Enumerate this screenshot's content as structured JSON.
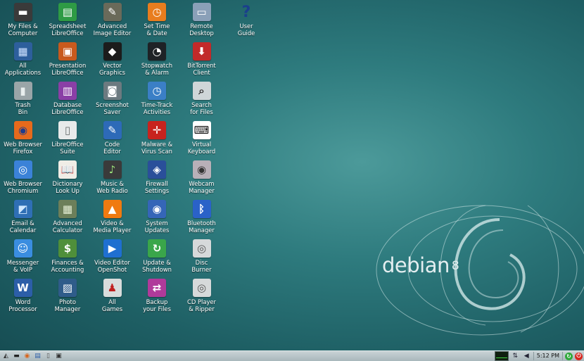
{
  "desktop_icons": [
    {
      "label": "My Files &\nComputer",
      "glyph": "▬",
      "bg": "#3a3a3a",
      "fg": "#ffffff"
    },
    {
      "label": "All\nApplications",
      "glyph": "▦",
      "bg": "#2d5f9c",
      "fg": "#cfe2ff"
    },
    {
      "label": "Trash\nBin",
      "glyph": "▮",
      "bg": "#9aa5a8",
      "fg": "#e8eeee"
    },
    {
      "label": "Web Browser\nFirefox",
      "glyph": "◉",
      "bg": "#e66a1c",
      "fg": "#1e3c8c"
    },
    {
      "label": "Web Browser\nChromium",
      "glyph": "◎",
      "bg": "#3b82d8",
      "fg": "#ffffff"
    },
    {
      "label": "Email &\nCalendar",
      "glyph": "◩",
      "bg": "#2f6fb5",
      "fg": "#cfe7ff"
    },
    {
      "label": "Messenger\n& VoIP",
      "glyph": "☺",
      "bg": "#3a8de0",
      "fg": "#ffffff"
    },
    {
      "label": "Word\nProcessor",
      "glyph": "W",
      "bg": "#2c5ea8",
      "fg": "#ffffff"
    },
    {
      "label": "Spreadsheet\nLibreOffice",
      "glyph": "▤",
      "bg": "#2e9b45",
      "fg": "#ffffff"
    },
    {
      "label": "Presentation\nLibreOffice",
      "glyph": "▣",
      "bg": "#c85a1e",
      "fg": "#ffffff"
    },
    {
      "label": "Database\nLibreOffice",
      "glyph": "▥",
      "bg": "#8a3fa6",
      "fg": "#ffffff"
    },
    {
      "label": "LibreOffice\nSuite",
      "glyph": "▯",
      "bg": "#e8eaea",
      "fg": "#6b7070"
    },
    {
      "label": "Dictionary\nLook Up",
      "glyph": "📖",
      "bg": "#f0ede6",
      "fg": "#8a2020"
    },
    {
      "label": "Advanced\nCalculator",
      "glyph": "▦",
      "bg": "#6c7f5a",
      "fg": "#e6f0d8"
    },
    {
      "label": "Finances &\nAccounting",
      "glyph": "$",
      "bg": "#4f8f3a",
      "fg": "#ffffff"
    },
    {
      "label": "Photo\nManager",
      "glyph": "▨",
      "bg": "#2f5c8a",
      "fg": "#ffffff"
    },
    {
      "label": "Advanced\nImage Editor",
      "glyph": "✎",
      "bg": "#6a6a5a",
      "fg": "#ffffff"
    },
    {
      "label": "Vector\nGraphics",
      "glyph": "◆",
      "bg": "#1c1c1c",
      "fg": "#ffffff"
    },
    {
      "label": "Screenshot\nSaver",
      "glyph": "◙",
      "bg": "#6c7a80",
      "fg": "#ffffff"
    },
    {
      "label": "Code\nEditor",
      "glyph": "✎",
      "bg": "#2d6ab8",
      "fg": "#ffffff"
    },
    {
      "label": "Music &\nWeb Radio",
      "glyph": "♪",
      "bg": "#3a3a3a",
      "fg": "#9be27a"
    },
    {
      "label": "Video &\nMedia Player",
      "glyph": "▲",
      "bg": "#f07a10",
      "fg": "#ffffff"
    },
    {
      "label": "Video Editor\nOpenShot",
      "glyph": "▶",
      "bg": "#1f6fd0",
      "fg": "#ffffff"
    },
    {
      "label": "All\nGames",
      "glyph": "♟",
      "bg": "#d8dcdc",
      "fg": "#c02020"
    },
    {
      "label": "Set Time\n& Date",
      "glyph": "◷",
      "bg": "#e87d1e",
      "fg": "#ffffff"
    },
    {
      "label": "Stopwatch\n& Alarm",
      "glyph": "◔",
      "bg": "#1e2226",
      "fg": "#ffffff"
    },
    {
      "label": "Time-Track\nActivities",
      "glyph": "◷",
      "bg": "#3b7fc6",
      "fg": "#ffffff"
    },
    {
      "label": "Malware &\nVirus Scan",
      "glyph": "✛",
      "bg": "#c8231e",
      "fg": "#ffffff"
    },
    {
      "label": "Firewall\nSettings",
      "glyph": "◈",
      "bg": "#2a4f9a",
      "fg": "#ffffff"
    },
    {
      "label": "System\nUpdates",
      "glyph": "◉",
      "bg": "#3566b8",
      "fg": "#ffffff"
    },
    {
      "label": "Update &\nShutdown",
      "glyph": "↻",
      "bg": "#3aa64a",
      "fg": "#ffffff"
    },
    {
      "label": "Backup\nyour Files",
      "glyph": "⇄",
      "bg": "#b03a9a",
      "fg": "#ffffff"
    },
    {
      "label": "Remote\nDesktop",
      "glyph": "▭",
      "bg": "#8aa0b8",
      "fg": "#ffffff"
    },
    {
      "label": "BitTorrent\nClient",
      "glyph": "⬇",
      "bg": "#c22a2a",
      "fg": "#ffffff"
    },
    {
      "label": "Search\nfor Files",
      "glyph": "⌕",
      "bg": "#cfd6d8",
      "fg": "#333333"
    },
    {
      "label": "Virtual\nKeyboard",
      "glyph": "⌨",
      "bg": "#ffffff",
      "fg": "#111111"
    },
    {
      "label": "Webcam\nManager",
      "glyph": "◉",
      "bg": "#b8b0b8",
      "fg": "#333333"
    },
    {
      "label": "Bluetooth\nManager",
      "glyph": "ᛒ",
      "bg": "#2a62c8",
      "fg": "#ffffff"
    },
    {
      "label": "Disc\nBurner",
      "glyph": "◎",
      "bg": "#d6d9da",
      "fg": "#555555"
    },
    {
      "label": "CD Player\n& Ripper",
      "glyph": "◎",
      "bg": "#d6d9da",
      "fg": "#555555"
    },
    {
      "label": "User\nGuide",
      "glyph": "?",
      "bg": "transparent",
      "fg": "#1a3f8c"
    }
  ],
  "logo": {
    "name": "debian",
    "version": "8"
  },
  "taskbar": {
    "launchers": [
      {
        "name": "menu",
        "glyph": "◭"
      },
      {
        "name": "terminal",
        "glyph": "▬"
      },
      {
        "name": "firefox",
        "glyph": "◉"
      },
      {
        "name": "files",
        "glyph": "▤"
      },
      {
        "name": "text",
        "glyph": "▯"
      },
      {
        "name": "windows",
        "glyph": "▣"
      }
    ],
    "clock": "5:12 PM"
  },
  "colors": {
    "accent": "#2e7b7e",
    "taskbar": "#b8c4c7"
  }
}
